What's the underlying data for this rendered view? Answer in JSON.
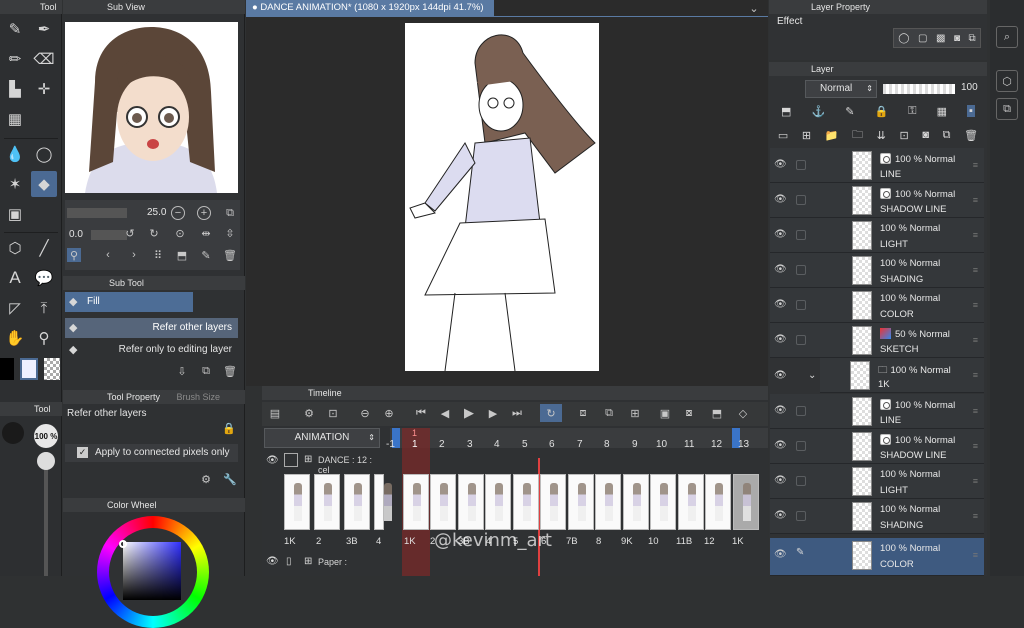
{
  "tool_panel": {
    "title": "Tool"
  },
  "subview": {
    "title": "Sub View"
  },
  "canvas_tab": {
    "title": "DANCE ANIMATION* (1080 x 1920px 144dpi 41.7%)"
  },
  "navigator": {
    "zoom": "25.0",
    "angle": "0.0"
  },
  "subtool": {
    "title": "Sub Tool",
    "items": [
      "Fill",
      "Refer other layers",
      "Refer only to editing layer"
    ]
  },
  "tool_property": {
    "title": "Tool Property",
    "tab2": "Brush Size",
    "label": "Refer other layers",
    "apply_label": "Apply to connected pixels only"
  },
  "color_wheel": {
    "title": "Color Wheel"
  },
  "brush_size": {
    "percent": "100 %"
  },
  "layer_property": {
    "title": "Layer Property",
    "effect_label": "Effect"
  },
  "layer_panel": {
    "title": "Layer",
    "blend_mode": "Normal",
    "opacity": "100",
    "layers": [
      {
        "mode": "100 % Normal",
        "name": "LINE"
      },
      {
        "mode": "100 % Normal",
        "name": "SHADOW LINE"
      },
      {
        "mode": "100 % Normal",
        "name": "LIGHT"
      },
      {
        "mode": "100 % Normal",
        "name": "SHADING"
      },
      {
        "mode": "100 % Normal",
        "name": "COLOR"
      },
      {
        "mode": "50 % Normal",
        "name": "SKETCH"
      },
      {
        "mode": "100 % Normal",
        "name": "1K"
      },
      {
        "mode": "100 % Normal",
        "name": "LINE"
      },
      {
        "mode": "100 % Normal",
        "name": "SHADOW LINE"
      },
      {
        "mode": "100 % Normal",
        "name": "LIGHT"
      },
      {
        "mode": "100 % Normal",
        "name": "SHADING"
      },
      {
        "mode": "100 % Normal",
        "name": "COLOR"
      }
    ]
  },
  "timeline": {
    "title": "Timeline",
    "animation_name": "ANIMATION",
    "track_name": "DANCE : 12 : cel",
    "paper_track": "Paper :",
    "frame_numbers": [
      "-1",
      "1",
      "2",
      "3",
      "4",
      "5",
      "6",
      "7",
      "8",
      "9",
      "10",
      "11",
      "12",
      "13"
    ],
    "current_frame": "1",
    "left_labels": [
      "1K",
      "2",
      "3B",
      "4"
    ],
    "cel_labels": [
      "1K",
      "2",
      "3B",
      "4",
      "5",
      "6",
      "7B",
      "8",
      "9K",
      "10",
      "11B",
      "12",
      "1K"
    ],
    "watermark": "@kevinm_art"
  },
  "colors": {
    "accent": "#4b6a93",
    "playhead": "#e04040",
    "current_frame": "#b83030"
  }
}
